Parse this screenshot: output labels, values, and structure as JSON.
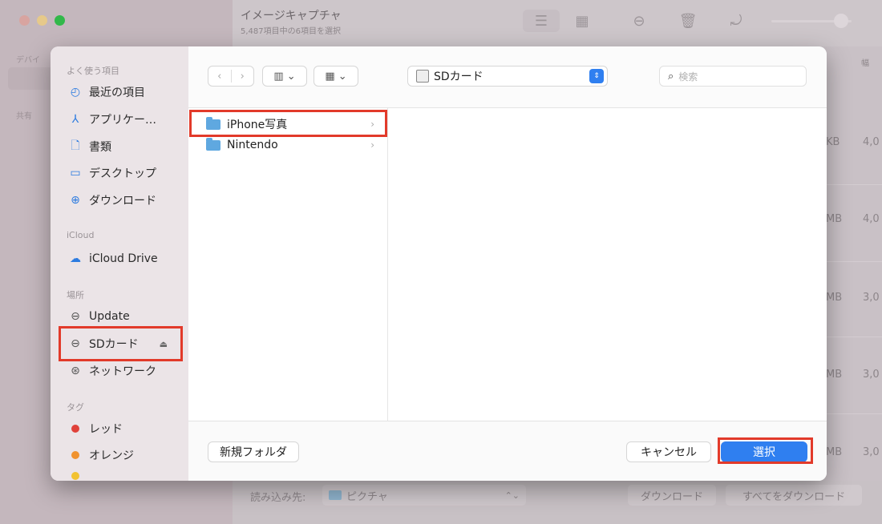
{
  "background_window": {
    "title": "イメージキャプチャ",
    "subtitle": "5,487項目中の6項目を選択",
    "sidebar": {
      "section_devices": "デバイ",
      "section_shared": "共有"
    },
    "column_header": "幅",
    "size_cells": [
      "KB",
      "MB",
      "MB",
      "MB",
      "MB"
    ],
    "width_cells": [
      "4,0",
      "4,0",
      "3,0",
      "3,0",
      "3,0"
    ],
    "import_label": "読み込み先:",
    "import_value": "ピクチャ",
    "download_button": "ダウンロード",
    "download_all_button": "すべてをダウンロード"
  },
  "dialog": {
    "sidebar": {
      "favorites_label": "よく使う項目",
      "favorites": [
        {
          "icon": "clock-icon",
          "label": "最近の項目"
        },
        {
          "icon": "applications-icon",
          "label": "アプリケー…"
        },
        {
          "icon": "document-icon",
          "label": "書類"
        },
        {
          "icon": "desktop-icon",
          "label": "デスクトップ"
        },
        {
          "icon": "download-icon",
          "label": "ダウンロード"
        }
      ],
      "icloud_label": "iCloud",
      "icloud": [
        {
          "icon": "cloud-icon",
          "label": "iCloud Drive"
        }
      ],
      "locations_label": "場所",
      "locations": [
        {
          "icon": "drive-icon",
          "label": "Update"
        },
        {
          "icon": "drive-icon",
          "label": "SDカード"
        },
        {
          "icon": "network-icon",
          "label": "ネットワーク"
        }
      ],
      "tags_label": "タグ",
      "tags": [
        {
          "label": "レッド",
          "color": "#e0413a"
        },
        {
          "label": "オレンジ",
          "color": "#f0922e"
        }
      ]
    },
    "toolbar": {
      "path": "SDカード",
      "search_placeholder": "検索"
    },
    "files": [
      {
        "name": "iPhone写真"
      },
      {
        "name": "Nintendo"
      }
    ],
    "footer": {
      "new_folder": "新規フォルダ",
      "cancel": "キャンセル",
      "select": "選択"
    }
  },
  "highlight_color": "#e23a2a"
}
